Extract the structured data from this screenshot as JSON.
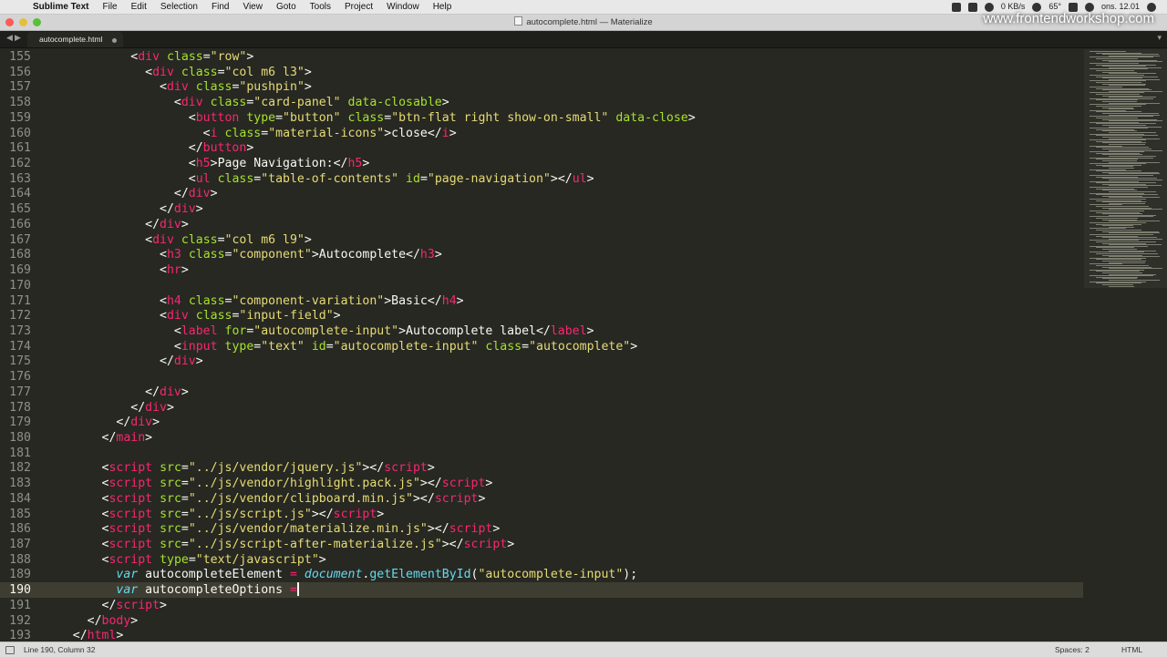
{
  "menubar": {
    "items": [
      "Sublime Text",
      "File",
      "Edit",
      "Selection",
      "Find",
      "View",
      "Goto",
      "Tools",
      "Project",
      "Window",
      "Help"
    ],
    "status_text": [
      "0 KB/s",
      "65°",
      "ons. 12.01"
    ]
  },
  "window": {
    "title": "autocomplete.html — Materialize"
  },
  "watermark": "www.frontendworkshop.com",
  "tab": {
    "label": "autocomplete.html"
  },
  "lines": [
    {
      "n": "155",
      "html": "            &lt;<span class=\"t\">div</span> <span class=\"a\">class</span>=<span class=\"s\">\"row\"</span>&gt;"
    },
    {
      "n": "156",
      "html": "              &lt;<span class=\"t\">div</span> <span class=\"a\">class</span>=<span class=\"s\">\"col m6 l3\"</span>&gt;"
    },
    {
      "n": "157",
      "html": "                &lt;<span class=\"t\">div</span> <span class=\"a\">class</span>=<span class=\"s\">\"pushpin\"</span>&gt;"
    },
    {
      "n": "158",
      "html": "                  &lt;<span class=\"t\">div</span> <span class=\"a\">class</span>=<span class=\"s\">\"card-panel\"</span> <span class=\"a\">data-closable</span>&gt;"
    },
    {
      "n": "159",
      "html": "                    &lt;<span class=\"t\">button</span> <span class=\"a\">type</span>=<span class=\"s\">\"button\"</span> <span class=\"a\">class</span>=<span class=\"s\">\"btn-flat right show-on-small\"</span> <span class=\"a\">data-close</span>&gt;"
    },
    {
      "n": "160",
      "html": "                      &lt;<span class=\"t\">i</span> <span class=\"a\">class</span>=<span class=\"s\">\"material-icons\"</span>&gt;close&lt;/<span class=\"t\">i</span>&gt;"
    },
    {
      "n": "161",
      "html": "                    &lt;/<span class=\"t\">button</span>&gt;"
    },
    {
      "n": "162",
      "html": "                    &lt;<span class=\"t\">h5</span>&gt;Page Navigation:&lt;/<span class=\"t\">h5</span>&gt;"
    },
    {
      "n": "163",
      "html": "                    &lt;<span class=\"t\">ul</span> <span class=\"a\">class</span>=<span class=\"s\">\"table-of-contents\"</span> <span class=\"a\">id</span>=<span class=\"s\">\"page-navigation\"</span>&gt;&lt;/<span class=\"t\">ul</span>&gt;"
    },
    {
      "n": "164",
      "html": "                  &lt;/<span class=\"t\">div</span>&gt;"
    },
    {
      "n": "165",
      "html": "                &lt;/<span class=\"t\">div</span>&gt;"
    },
    {
      "n": "166",
      "html": "              &lt;/<span class=\"t\">div</span>&gt;"
    },
    {
      "n": "167",
      "html": "              &lt;<span class=\"t\">div</span> <span class=\"a\">class</span>=<span class=\"s\">\"col m6 l9\"</span>&gt;"
    },
    {
      "n": "168",
      "html": "                &lt;<span class=\"t\">h3</span> <span class=\"a\">class</span>=<span class=\"s\">\"component\"</span>&gt;Autocomplete&lt;/<span class=\"t\">h3</span>&gt;"
    },
    {
      "n": "169",
      "html": "                &lt;<span class=\"t\">hr</span>&gt;"
    },
    {
      "n": "170",
      "html": ""
    },
    {
      "n": "171",
      "html": "                &lt;<span class=\"t\">h4</span> <span class=\"a\">class</span>=<span class=\"s\">\"component-variation\"</span>&gt;Basic&lt;/<span class=\"t\">h4</span>&gt;"
    },
    {
      "n": "172",
      "html": "                &lt;<span class=\"t\">div</span> <span class=\"a\">class</span>=<span class=\"s\">\"input-field\"</span>&gt;"
    },
    {
      "n": "173",
      "html": "                  &lt;<span class=\"t\">label</span> <span class=\"a\">for</span>=<span class=\"s\">\"autocomplete-input\"</span>&gt;Autocomplete label&lt;/<span class=\"t\">label</span>&gt;"
    },
    {
      "n": "174",
      "html": "                  &lt;<span class=\"t\">input</span> <span class=\"a\">type</span>=<span class=\"s\">\"text\"</span> <span class=\"a\">id</span>=<span class=\"s\">\"autocomplete-input\"</span> <span class=\"a\">class</span>=<span class=\"s\">\"autocomplete\"</span>&gt;"
    },
    {
      "n": "175",
      "html": "                &lt;/<span class=\"t\">div</span>&gt;"
    },
    {
      "n": "176",
      "html": ""
    },
    {
      "n": "177",
      "html": "              &lt;/<span class=\"t\">div</span>&gt;"
    },
    {
      "n": "178",
      "html": "            &lt;/<span class=\"t\">div</span>&gt;"
    },
    {
      "n": "179",
      "html": "          &lt;/<span class=\"t\">div</span>&gt;"
    },
    {
      "n": "180",
      "html": "        &lt;/<span class=\"t\">main</span>&gt;"
    },
    {
      "n": "181",
      "html": ""
    },
    {
      "n": "182",
      "html": "        &lt;<span class=\"t\">script</span> <span class=\"a\">src</span>=<span class=\"s\">\"../js/vendor/jquery.js\"</span>&gt;&lt;/<span class=\"t\">script</span>&gt;"
    },
    {
      "n": "183",
      "html": "        &lt;<span class=\"t\">script</span> <span class=\"a\">src</span>=<span class=\"s\">\"../js/vendor/highlight.pack.js\"</span>&gt;&lt;/<span class=\"t\">script</span>&gt;"
    },
    {
      "n": "184",
      "html": "        &lt;<span class=\"t\">script</span> <span class=\"a\">src</span>=<span class=\"s\">\"../js/vendor/clipboard.min.js\"</span>&gt;&lt;/<span class=\"t\">script</span>&gt;"
    },
    {
      "n": "185",
      "html": "        &lt;<span class=\"t\">script</span> <span class=\"a\">src</span>=<span class=\"s\">\"../js/script.js\"</span>&gt;&lt;/<span class=\"t\">script</span>&gt;"
    },
    {
      "n": "186",
      "html": "        &lt;<span class=\"t\">script</span> <span class=\"a\">src</span>=<span class=\"s\">\"../js/vendor/materialize.min.js\"</span>&gt;&lt;/<span class=\"t\">script</span>&gt;"
    },
    {
      "n": "187",
      "html": "        &lt;<span class=\"t\">script</span> <span class=\"a\">src</span>=<span class=\"s\">\"../js/script-after-materialize.js\"</span>&gt;&lt;/<span class=\"t\">script</span>&gt;"
    },
    {
      "n": "188",
      "html": "        &lt;<span class=\"t\">script</span> <span class=\"a\">type</span>=<span class=\"s\">\"text/javascript\"</span>&gt;"
    },
    {
      "n": "189",
      "html": "          <span class=\"k\">var</span> autocompleteElement <span class=\"o\">=</span> <span class=\"k\">document</span>.<span class=\"f\">getElementById</span>(<span class=\"s\">\"autocomplete-input\"</span>);"
    },
    {
      "n": "190",
      "html": "          <span class=\"k\">var</span> autocompleteOptions <span class=\"o\">=</span><span class=\"caret\"></span>",
      "current": true
    },
    {
      "n": "191",
      "html": "        &lt;/<span class=\"t\">script</span>&gt;"
    },
    {
      "n": "192",
      "html": "      &lt;/<span class=\"t\">body</span>&gt;"
    },
    {
      "n": "193",
      "html": "    &lt;/<span class=\"t\">html</span>&gt;"
    }
  ],
  "statusbar": {
    "position": "Line 190, Column 32",
    "spaces": "Spaces: 2",
    "syntax": "HTML"
  },
  "colors": {
    "background": "#272822",
    "tag": "#f92672",
    "string": "#e6db74",
    "attribute": "#a6e22e",
    "keyword": "#66d9ef",
    "text": "#f8f8f2"
  }
}
